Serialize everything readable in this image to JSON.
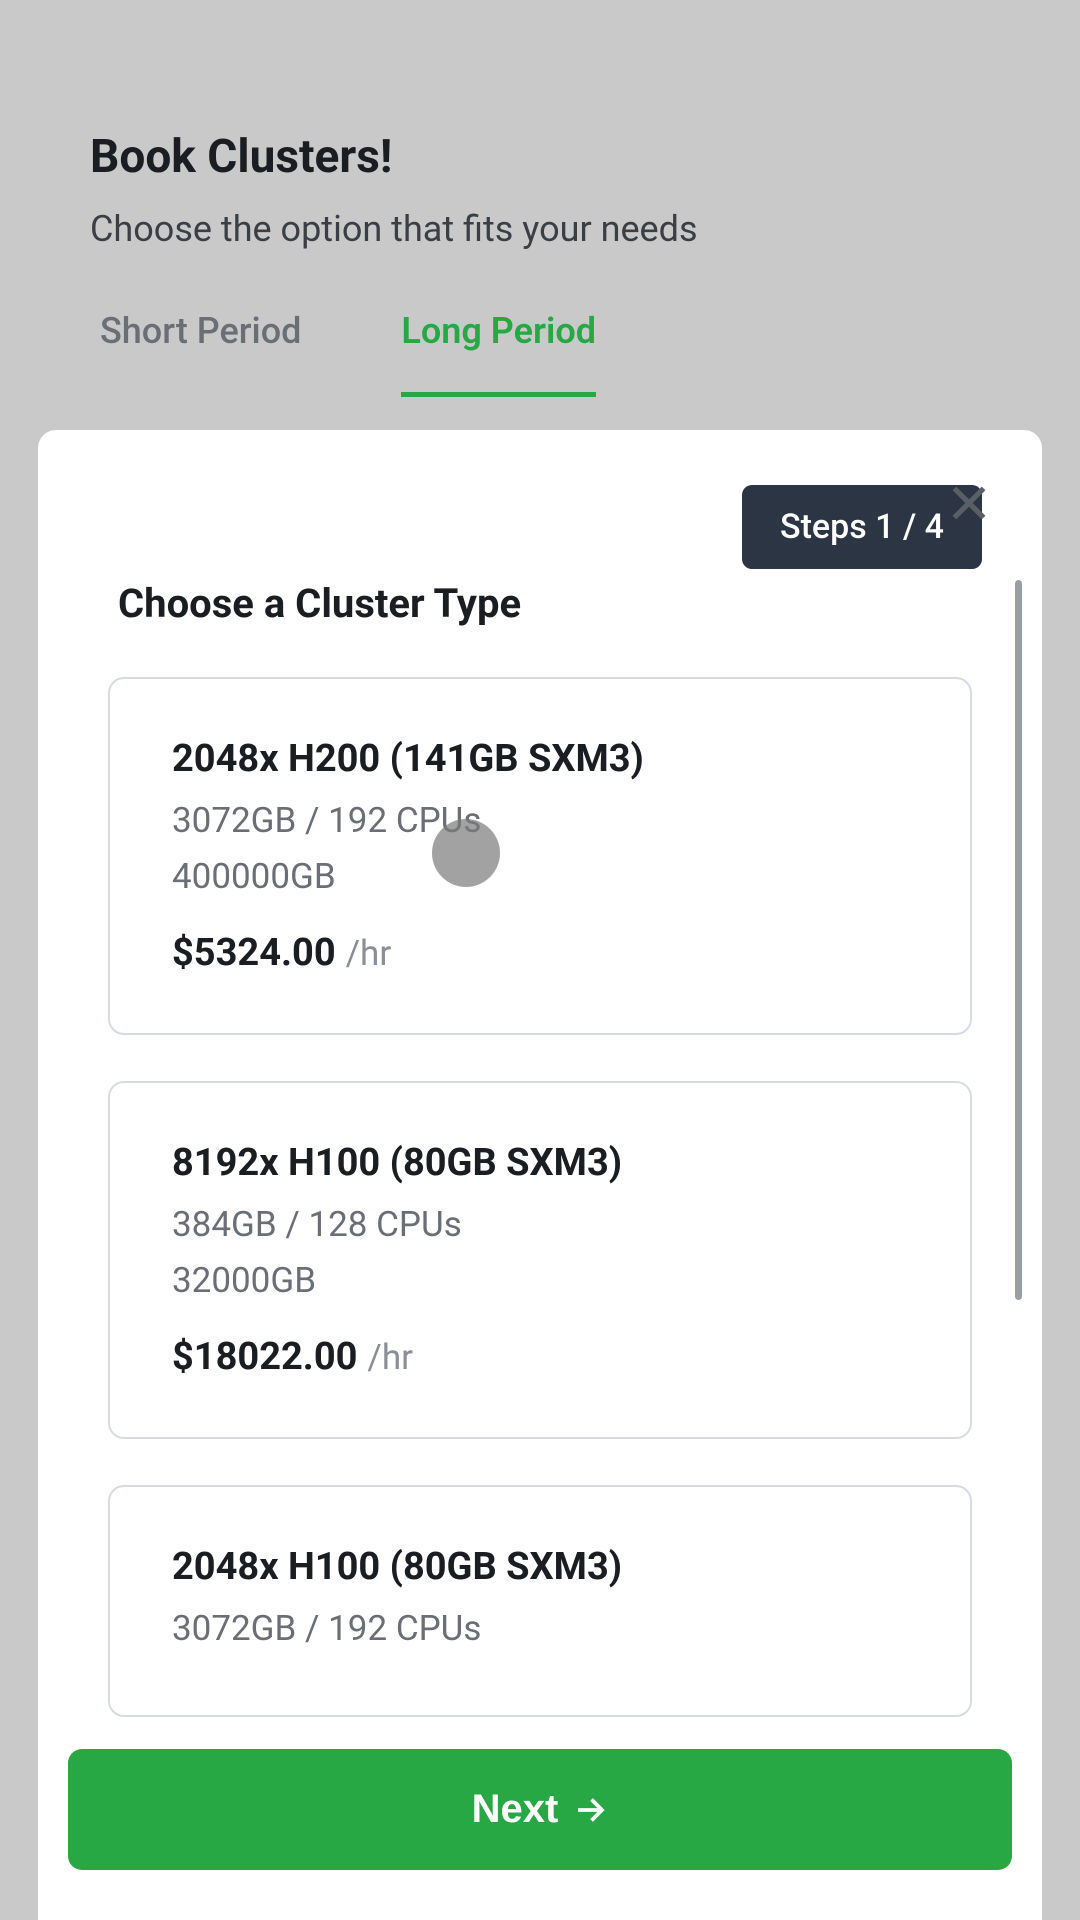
{
  "header": {
    "title": "Book Clusters!",
    "subtitle": "Choose the option that fits your needs"
  },
  "tabs": {
    "short": "Short Period",
    "long": "Long Period"
  },
  "panel": {
    "step_label": "Steps 1 / 4",
    "section_title": "Choose a Cluster Type",
    "next_label": "Next"
  },
  "options": [
    {
      "title": "2048x H200 (141GB SXM3)",
      "spec1": "3072GB / 192 CPUs",
      "spec2": "400000GB",
      "price": "$5324.00",
      "unit": "/hr"
    },
    {
      "title": "8192x H100 (80GB SXM3)",
      "spec1": "384GB / 128 CPUs",
      "spec2": "32000GB",
      "price": "$18022.00",
      "unit": "/hr"
    },
    {
      "title": "2048x H100 (80GB SXM3)",
      "spec1": "3072GB / 192 CPUs",
      "spec2": "",
      "price": "",
      "unit": ""
    }
  ]
}
